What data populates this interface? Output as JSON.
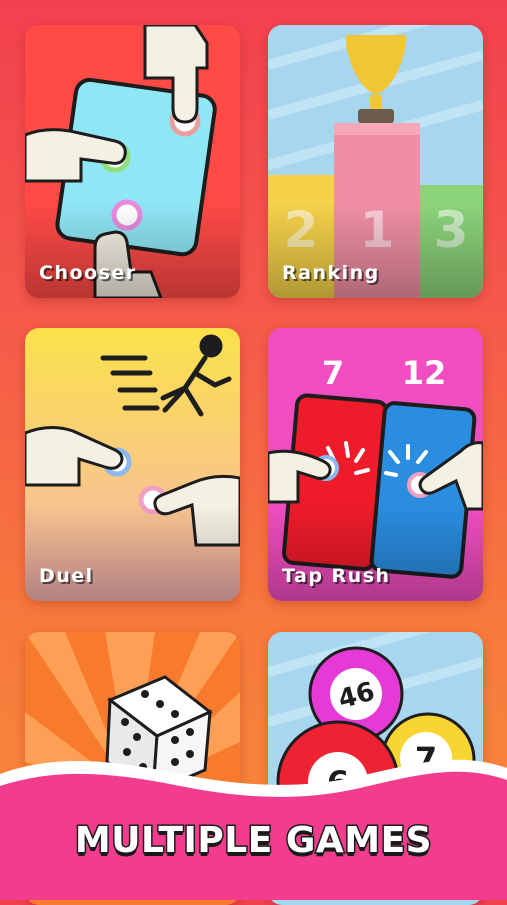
{
  "games": [
    {
      "id": "chooser",
      "label": "Chooser"
    },
    {
      "id": "ranking",
      "label": "Ranking",
      "digits": [
        "2",
        "1",
        "3"
      ]
    },
    {
      "id": "duel",
      "label": "Duel"
    },
    {
      "id": "taprush",
      "label": "Tap Rush",
      "scores": [
        "7",
        "12"
      ]
    },
    {
      "id": "dice",
      "label": ""
    },
    {
      "id": "bingo",
      "label": "",
      "balls": [
        "46",
        "7",
        "6"
      ]
    }
  ],
  "footer": {
    "banner": "MULTIPLE GAMES"
  },
  "colors": {
    "accent": "#f23d8e",
    "background_top": "#f2404f",
    "background_bottom": "#f88a3a"
  }
}
